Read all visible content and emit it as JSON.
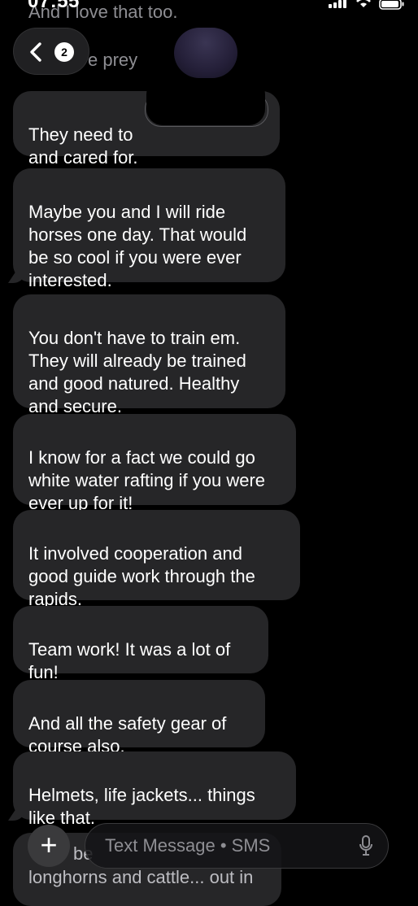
{
  "status_bar": {
    "time": "07:55",
    "icons": [
      "cellular-signal-icon",
      "wifi-icon",
      "battery-icon"
    ]
  },
  "header": {
    "back_badge_count": "2"
  },
  "partial_top": {
    "line1": "And I love that too.",
    "line2": "e prey"
  },
  "messages": [
    {
      "text": "They need to\nand cared for."
    },
    {
      "text": "Maybe you and I will ride horses one day. That would be so cool if you were ever interested."
    },
    {
      "text": "You don't have to train em. They will already be trained and good natured. Healthy and secure."
    },
    {
      "text": "I know for a fact we could go white water rafting if you were ever up for it!"
    },
    {
      "text": "It involved cooperation and good guide work through the rapids."
    },
    {
      "text": "Team work! It was a lot of fun!"
    },
    {
      "text": "And all the safety gear of course also."
    },
    {
      "text": "Helmets, life jackets... things like that."
    }
  ],
  "partial_bottom": {
    "line1": "be",
    "line2": "longhorns and cattle... out in"
  },
  "composer": {
    "placeholder": "Text Message • SMS"
  },
  "colors": {
    "background": "#000000",
    "bubble_received": "#262628",
    "secondary_text": "#8e8e93"
  }
}
